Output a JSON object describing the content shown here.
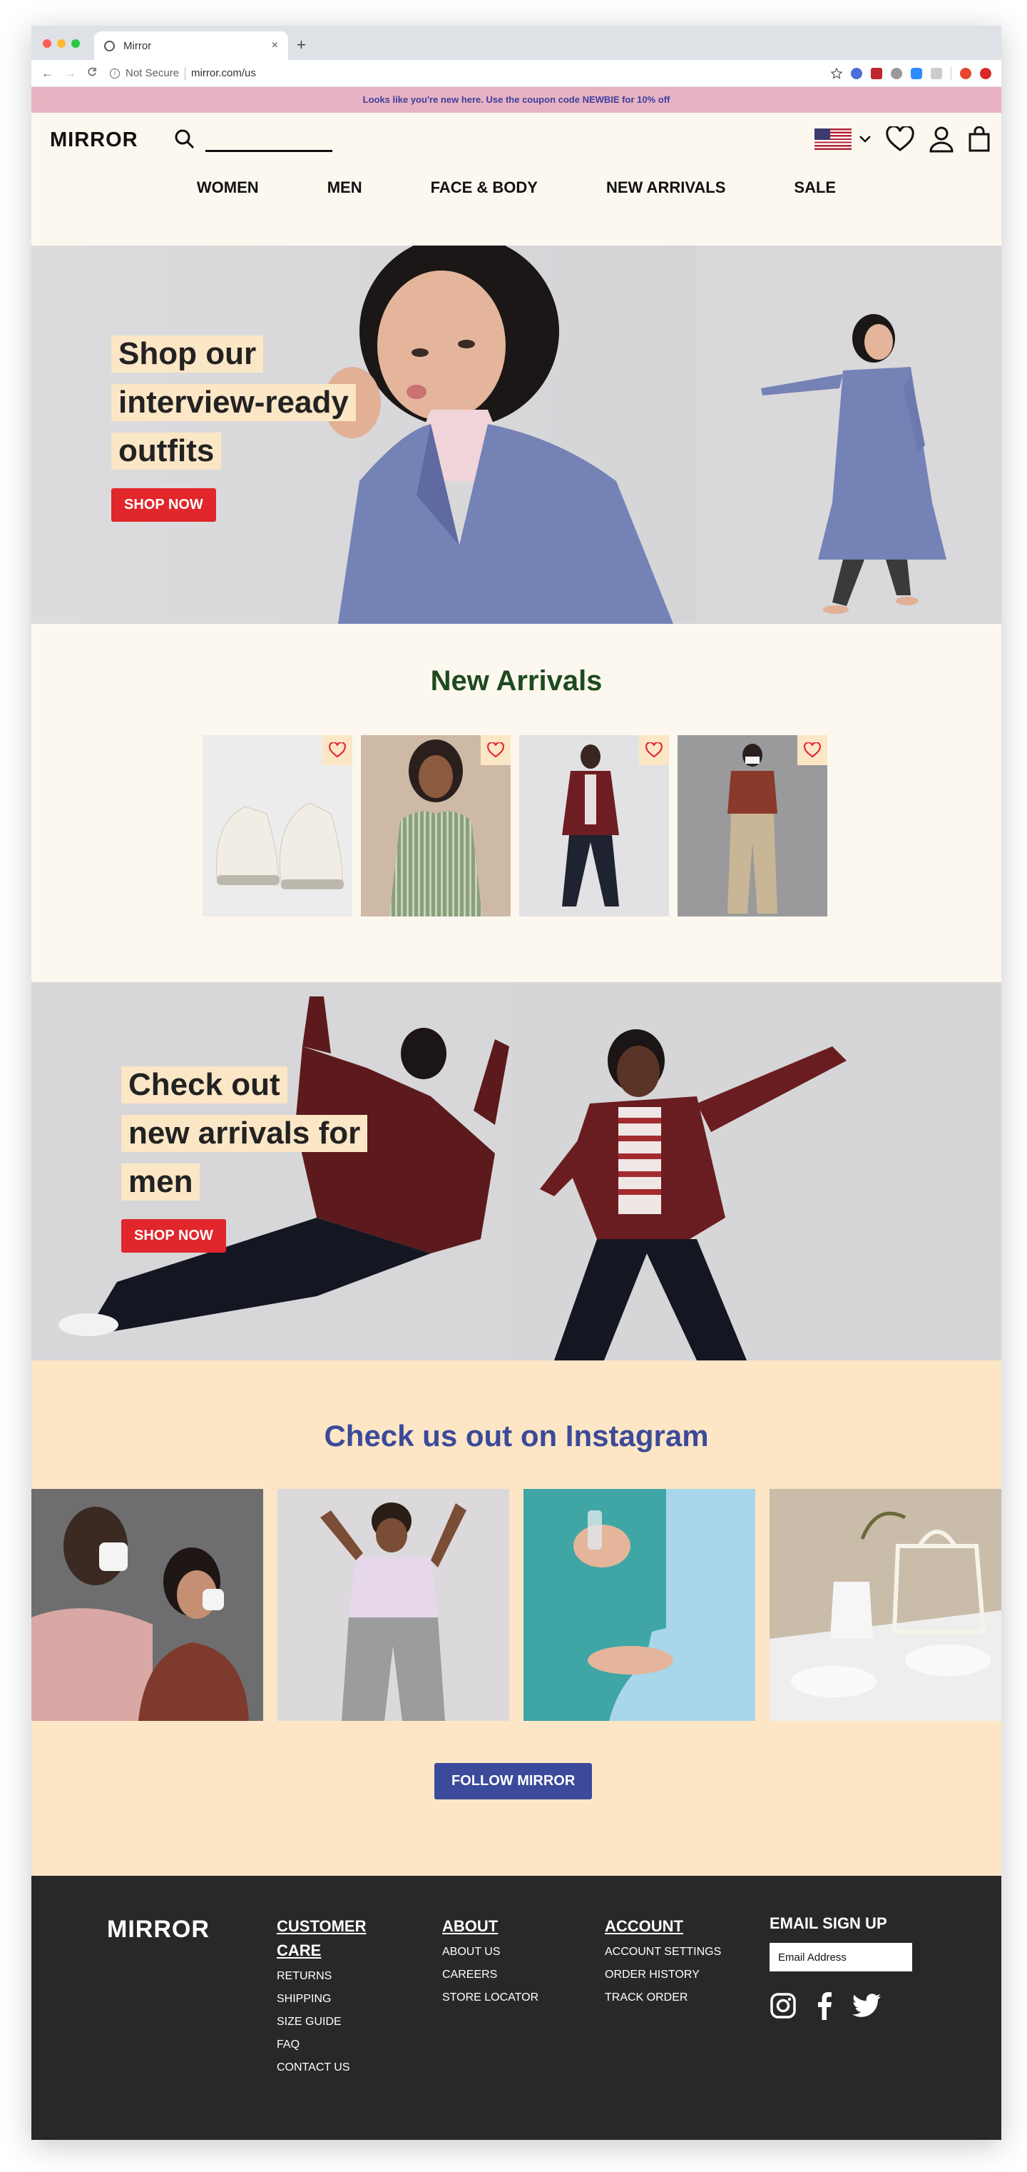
{
  "browser": {
    "tab_title": "Mirror",
    "new_tab": "+",
    "close": "×",
    "back": "←",
    "forward": "→",
    "reload": "C",
    "not_secure": "Not Secure",
    "url": "mirror.com/us"
  },
  "promo": {
    "text": "Looks like you're new here. Use the coupon code NEWBIE for 10% off"
  },
  "header": {
    "logo": "MIRROR",
    "nav": [
      "WOMEN",
      "MEN",
      "FACE & BODY",
      "NEW ARRIVALS",
      "SALE"
    ]
  },
  "hero": {
    "lines": [
      "Shop our",
      "interview-ready",
      "outfits"
    ],
    "cta": "SHOP NOW"
  },
  "arrivals": {
    "title": "New Arrivals",
    "products": [
      "sneakers",
      "striped-dress",
      "maroon-jacket-outfit",
      "rust-top-khakis"
    ]
  },
  "men": {
    "lines": [
      "Check out",
      "new arrivals for",
      "men"
    ],
    "cta": "SHOP NOW"
  },
  "instagram": {
    "title": "Check us out on Instagram",
    "cta": "FOLLOW MIRROR"
  },
  "footer": {
    "logo": "MIRROR",
    "customer_care": {
      "title_line1": "CUSTOMER",
      "title_line2": "CARE",
      "links": [
        "RETURNS",
        "SHIPPING",
        "SIZE GUIDE",
        "FAQ",
        "CONTACT US"
      ]
    },
    "about": {
      "title": "ABOUT",
      "links": [
        "ABOUT US",
        "CAREERS",
        "STORE LOCATOR"
      ]
    },
    "account": {
      "title": "ACCOUNT",
      "links": [
        "ACCOUNT SETTINGS",
        "ORDER HISTORY",
        "TRACK ORDER"
      ]
    },
    "email": {
      "title": "EMAIL SIGN UP",
      "placeholder": "Email Address"
    }
  },
  "colors": {
    "promo_bg": "#e7b2c1",
    "cream": "#fdf8ef",
    "peach": "#fde6c5",
    "cta_red": "#e1262c",
    "green": "#1e4a1f",
    "blue": "#3b4a9a",
    "footer_bg": "#282828"
  }
}
